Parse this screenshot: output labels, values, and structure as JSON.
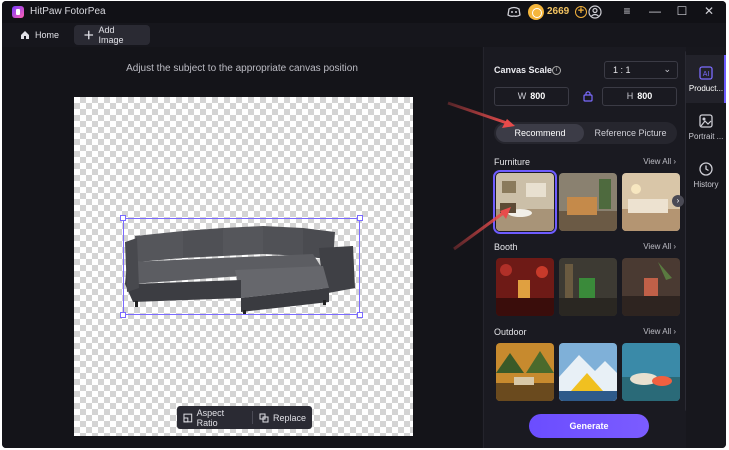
{
  "app": {
    "title": "HitPaw FotorPea",
    "credits": "2669"
  },
  "tabs": [
    {
      "label": "Home"
    },
    {
      "label": "Add Image"
    }
  ],
  "main": {
    "hint": "Adjust the subject to the appropriate canvas position",
    "toolbar": {
      "aspect_ratio_label": "Aspect Ratio",
      "replace_label": "Replace"
    }
  },
  "panel": {
    "canvas_scale_label": "Canvas Scale",
    "ratio": "1 : 1",
    "width": {
      "prefix": "W",
      "value": "800"
    },
    "height": {
      "prefix": "H",
      "value": "800"
    },
    "segments": [
      {
        "label": "Recommend"
      },
      {
        "label": "Reference Picture"
      }
    ],
    "sections": [
      {
        "title": "Furniture",
        "view_all": "View All"
      },
      {
        "title": "Booth",
        "view_all": "View All"
      },
      {
        "title": "Outdoor",
        "view_all": "View All"
      }
    ],
    "generate_label": "Generate"
  },
  "sidenav": [
    {
      "label": "Product...",
      "icon": "ai-icon"
    },
    {
      "label": "Portrait ...",
      "icon": "portrait-icon"
    },
    {
      "label": "History",
      "icon": "clock-icon"
    }
  ],
  "colors": {
    "accent": "#6e5cff",
    "annotation_arrow": "#e84b4b",
    "coin": "#f5b63c"
  }
}
